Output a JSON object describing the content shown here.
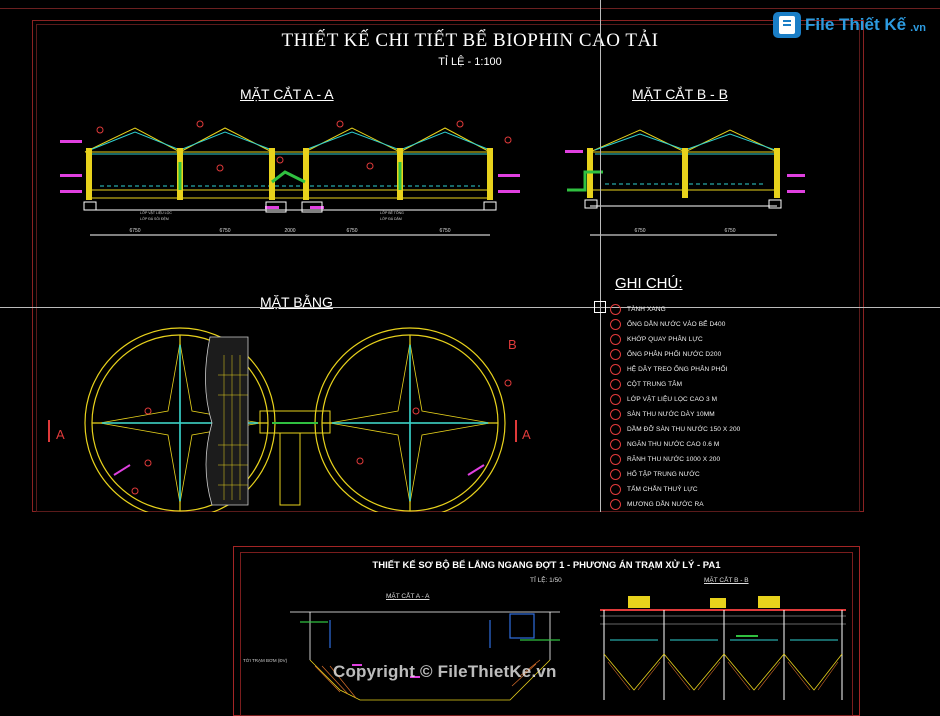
{
  "watermark": {
    "brand": "File Thiết Kế",
    "brand_suffix": ".vn",
    "copyright": "Copyright © FileThietKe.vn"
  },
  "sheet1": {
    "title": "THIẾT KẾ CHI TIẾT BỂ BIOPHIN CAO TẢI",
    "scale": "TỈ LỆ - 1:100",
    "section_aa": "MẶT CẮT A - A",
    "section_bb": "MẶT CẮT B - B",
    "plan": "MẶT BẰNG",
    "cut_a_label": "A",
    "cut_b_label": "B",
    "dims_aa": [
      "6750",
      "6750",
      "2000",
      "6750",
      "6750"
    ],
    "dims_bb": [
      "6750",
      "6750"
    ],
    "notes_title": "GHI CHÚ:",
    "notes": [
      "TÀNH XANG",
      "ỐNG DẪN NƯỚC VÀO BỂ D400",
      "KHỚP QUAY PHÂN LỰC",
      "ỐNG PHÂN PHỐI NƯỚC D200",
      "HỆ DÂY TREO ỐNG PHÂN PHỐI",
      "CỘT TRUNG TÂM",
      "LỚP VẬT LIỆU LỌC CAO 3 M",
      "SÀN THU NƯỚC DÀY 10MM",
      "DẦM ĐỠ SÀN THU NƯỚC 150 X 200",
      "NGĂN THU NƯỚC CAO 0.6 M",
      "RÃNH THU NƯỚC 1000 X 200",
      "HỐ TẬP TRUNG NƯỚC",
      "TẤM CHẮN THUỶ LỰC",
      "MƯƠNG DẪN NƯỚC RA"
    ]
  },
  "sheet2": {
    "title": "THIẾT KẾ SƠ BỘ BỂ LẮNG NGANG ĐỢT 1 - PHƯƠNG ÁN TRẠM XỬ LÝ - PA1",
    "scale": "TỈ LỆ: 1/50",
    "section_aa": "MẶT CẮT A - A",
    "section_bb": "MẶT CẮT B - B",
    "side_note": "TỚI TRẠM BƠM (ĐV)"
  },
  "colors": {
    "background": "#000000",
    "frame_red": "#a32525",
    "cad_yellow": "#e8d21c",
    "cad_cyan": "#2fd0d0",
    "cad_green": "#30c040",
    "cad_magenta": "#e040e0",
    "cad_red": "#e03a3a",
    "cad_white": "#ffffff"
  }
}
